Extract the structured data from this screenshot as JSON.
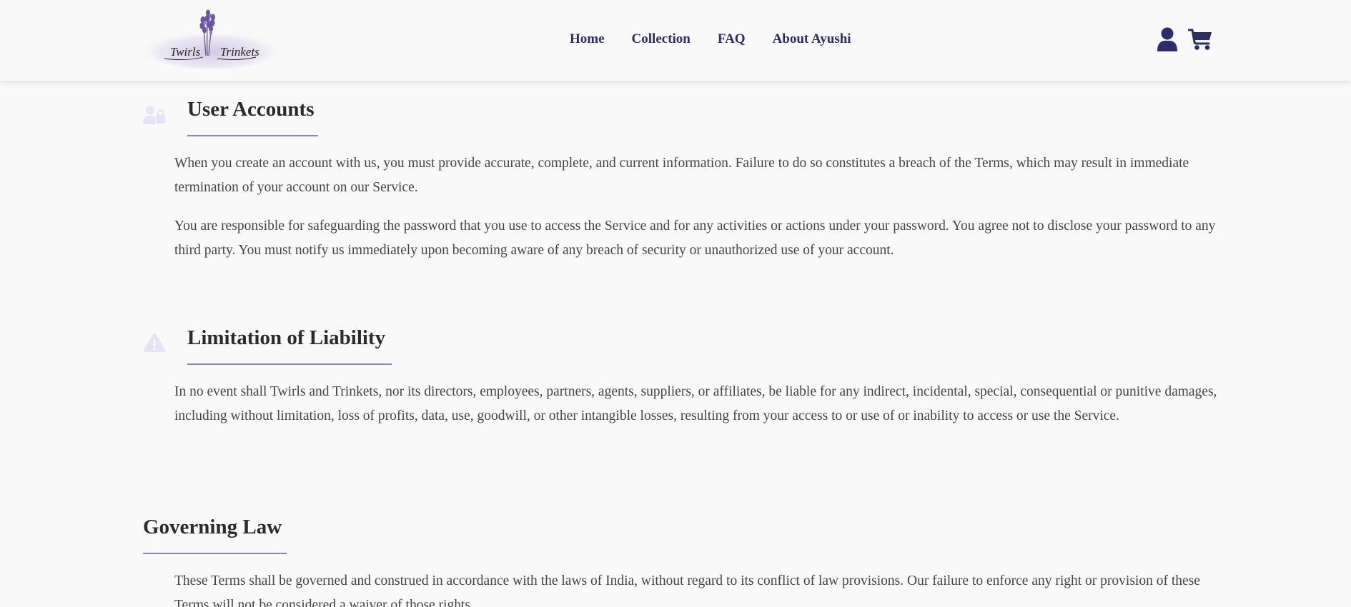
{
  "header": {
    "logo": {
      "text_left": "Twirls",
      "text_right": "Trinkets"
    },
    "nav": [
      {
        "label": "Home"
      },
      {
        "label": "Collection"
      },
      {
        "label": "FAQ"
      },
      {
        "label": "About Ayushi"
      }
    ],
    "icons": [
      "user-icon",
      "cart-icon"
    ],
    "accent_color": "#2a2d6c"
  },
  "sections": [
    {
      "icon": "user-lock-icon",
      "title": "User Accounts",
      "paragraphs": [
        "When you create an account with us, you must provide accurate, complete, and current information. Failure to do so constitutes a breach of the Terms, which may result in immediate termination of your account on our Service.",
        "You are responsible for safeguarding the password that you use to access the Service and for any activities or actions under your password. You agree not to disclose your password to any third party. You must notify us immediately upon becoming aware of any breach of security or unauthorized use of your account."
      ]
    },
    {
      "icon": "warning-icon",
      "title": "Limitation of Liability",
      "paragraphs": [
        "In no event shall Twirls and Trinkets, nor its directors, employees, partners, agents, suppliers, or affiliates, be liable for any indirect, incidental, special, consequential or punitive damages, including without limitation, loss of profits, data, use, goodwill, or other intangible losses, resulting from your access to or use of or inability to access or use the Service."
      ]
    },
    {
      "title": "Governing Law",
      "paragraphs": [
        "These Terms shall be governed and construed in accordance with the laws of India, without regard to its conflict of law provisions. Our failure to enforce any right or provision of these Terms will not be considered a waiver of those rights."
      ]
    }
  ],
  "colors": {
    "heading_rule": "#8b80c9",
    "section_icon": "#e6e3f5",
    "page_background": "#f9f9f9"
  }
}
